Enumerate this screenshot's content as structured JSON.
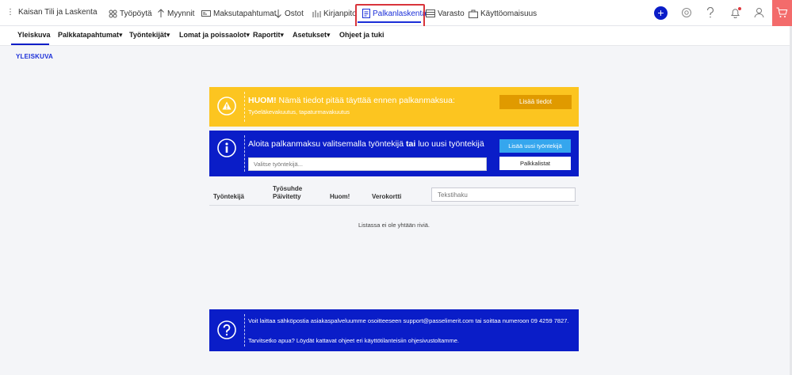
{
  "topbar": {
    "company": "Kaisan Tili ja Laskenta",
    "nav": [
      {
        "label": "Työpöytä",
        "icon": "dashboard-icon"
      },
      {
        "label": "Myynnit",
        "icon": "arrow-up-icon"
      },
      {
        "label": "Maksutapahtumat",
        "icon": "bank-icon"
      },
      {
        "label": "Ostot",
        "icon": "arrow-down-icon"
      },
      {
        "label": "Kirjanpito",
        "icon": "ledger-icon"
      },
      {
        "label": "Palkanlaskenta",
        "icon": "payroll-icon",
        "active": true
      },
      {
        "label": "Varasto",
        "icon": "warehouse-icon"
      },
      {
        "label": "Käyttöomaisuus",
        "icon": "assets-icon"
      }
    ],
    "plus_label": "+"
  },
  "subnav": {
    "items": [
      "Yleiskuva",
      "Palkkatapahtumat▾",
      "Työntekijät▾",
      "Lomat ja poissaolot▾",
      "Raportit▾",
      "Asetukset▾",
      "Ohjeet ja tuki"
    ]
  },
  "page": {
    "title": "YLEISKUVA"
  },
  "warning": {
    "title_bold": "HUOM!",
    "title_rest": " Nämä tiedot pitää täyttää ennen palkanmaksua:",
    "sub": "Työeläkevakuutus, tapaturmavakuutus",
    "button": "Lisää tiedot"
  },
  "info": {
    "title_pre": "Aloita palkanmaksu valitsemalla työntekijä ",
    "title_bold": "tai",
    "title_post": " luo uusi työntekijä",
    "input_placeholder": "Valitse työntekijä...",
    "button_new": "Lisää uusi työntekijä",
    "button_lists": "Palkkalistat"
  },
  "table": {
    "headers": {
      "employee": "Työntekijä",
      "relation_line1": "Työsuhde",
      "relation_line2": "Päivitetty",
      "note": "Huom!",
      "tax_card": "Verokortti"
    },
    "search_placeholder": "Tekstihaku",
    "empty": "Listassa ei ole yhtään riviä."
  },
  "help": {
    "line1": "Voit laittaa sähköpostia asiakaspalveluumme osoitteeseen support@passelimerit.com tai soittaa numeroon 09 4259 7827.",
    "line2_pre": "Tarvitsetko apua? Löydät kattavat ohjeet eri käyttötilanteisiin ",
    "line2_post": " ohjesivustoltamme."
  },
  "colors": {
    "accent": "#0a1dc8",
    "warning": "#fcc520",
    "warning_button": "#e09a00",
    "highlight": "#d9343b",
    "cart": "#f36b6b"
  }
}
